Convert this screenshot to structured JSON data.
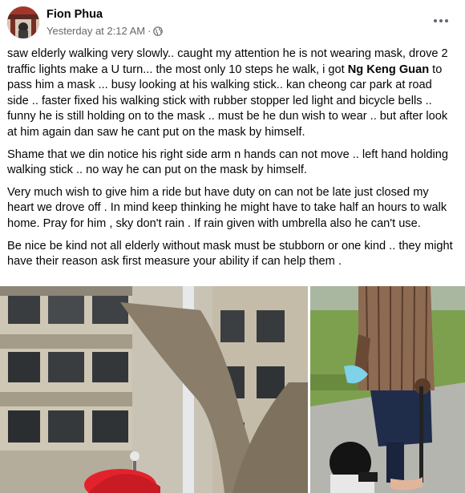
{
  "post": {
    "author": "Fion Phua",
    "timestamp": "Yesterday at 2:12 AM",
    "separator": "·",
    "privacy_icon": "globe-icon",
    "more_icon": "more-options-icon",
    "paragraphs": [
      {
        "before": "saw elderly walking very slowly.. caught my attention he is not wearing mask, drove 2 traffic lights make a U turn...  the most only 10 steps he walk, i got ",
        "mention": "Ng Keng Guan",
        "after": " to pass him a mask ... busy looking at his walking stick.. kan cheong car park at road side .. faster fixed his walking stick with rubber stopper led light and bicycle bells .. funny he is still holding on to the mask .. must be he dun wish to wear .. but after look at him again dan saw he cant put on the mask by himself."
      },
      {
        "text": "Shame that we din notice his right side arm n hands can not move .. left hand holding walking stick .. no way he can put on the mask by himself."
      },
      {
        "text": "Very much wish to give him a ride but have duty on can not be late just closed my heart we drove off .  In mind keep thinking he might have to take half an hours to walk home.  Pray for him , sky don't rain .  If rain given with umbrella also he can't use."
      },
      {
        "text": "Be nice be kind not all elderly without mask must be stubborn or one kind .. they might have their reason ask first measure your ability if can help them ."
      }
    ],
    "photos": [
      "photo-building-tree",
      "photo-walking-stick"
    ]
  }
}
